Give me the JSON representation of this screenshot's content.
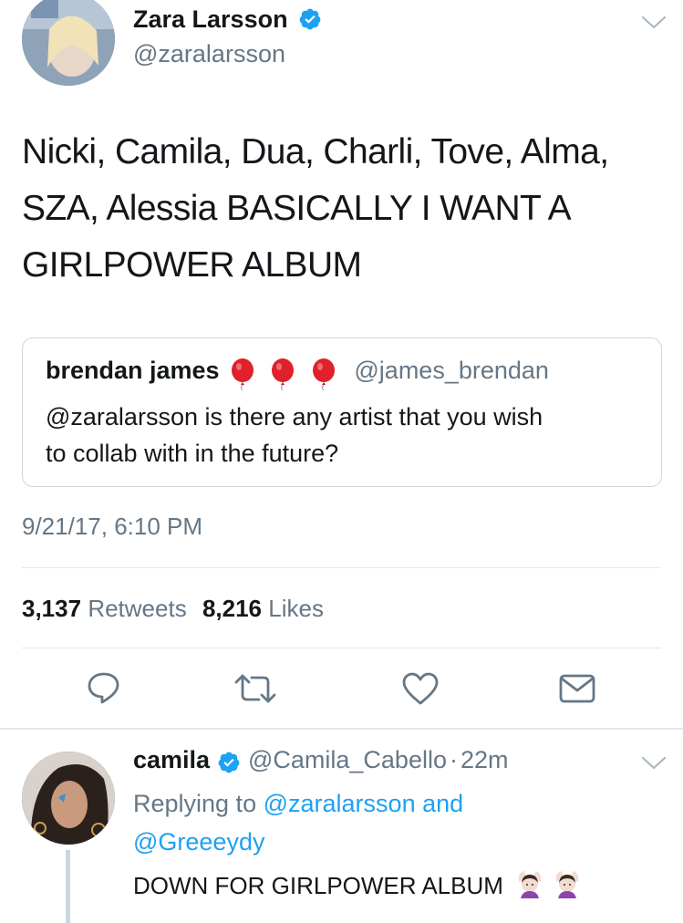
{
  "main_tweet": {
    "author_name": "Zara Larsson",
    "author_handle": "@zaralarsson",
    "text_lines": [
      "Nicki, Camila, Dua, Charli, Tove, Alma,",
      "SZA, Alessia BASICALLY I WANT A",
      "GIRLPOWER ALBUM"
    ],
    "timestamp": "9/21/17, 6:10 PM",
    "retweets_count": "3,137",
    "retweets_label": "Retweets",
    "likes_count": "8,216",
    "likes_label": "Likes"
  },
  "quoted_tweet": {
    "author_name": "brendan james",
    "author_handle": "@james_brendan",
    "text_lines": [
      "@zaralarsson is there any artist that you wish",
      "to collab with in the future?"
    ],
    "name_emojis": [
      "balloon-icon",
      "balloon-icon",
      "balloon-icon"
    ]
  },
  "actions": [
    "reply-icon",
    "retweet-icon",
    "like-icon",
    "message-icon"
  ],
  "reply_tweet": {
    "author_name": "camila",
    "author_handle": "@Camila_Cabello",
    "separator": "·",
    "time_ago": "22m",
    "replying_prefix": "Replying to",
    "replying_to_1": "@zaralarsson and",
    "replying_to_2": "@Greeeydy",
    "text": "DOWN FOR GIRLPOWER ALBUM",
    "text_emojis": [
      "woman-gesturing-ok-icon",
      "woman-gesturing-ok-icon"
    ]
  },
  "colors": {
    "accent": "#1da1f2",
    "muted": "#657786",
    "text": "#14171a",
    "divider": "#e1e8ed",
    "balloon": "#e0202b"
  }
}
